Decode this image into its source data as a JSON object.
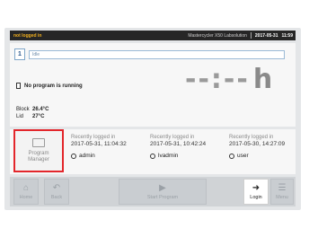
{
  "status": {
    "login_state": "not logged in",
    "model": "Mastercycler X50 Labsolution",
    "date": "2017-05-31",
    "time": "11:59"
  },
  "block": {
    "number": "1",
    "id_value": "Idle"
  },
  "program": {
    "status_text": "No program is running",
    "remaining": "--:--",
    "unit": "h"
  },
  "temperatures": {
    "block_label": "Block",
    "block_value": "26.4°C",
    "lid_label": "Lid",
    "lid_value": "27°C"
  },
  "program_manager": {
    "label_line1": "Program",
    "label_line2": "Manager"
  },
  "recent_users": [
    {
      "title": "Recently logged in",
      "datetime": "2017-05-31, 11:04:32",
      "name": "admin"
    },
    {
      "title": "Recently logged in",
      "datetime": "2017-05-31, 10:42:24",
      "name": "lvadmin"
    },
    {
      "title": "Recently logged in",
      "datetime": "2017-05-30, 14:27:09",
      "name": "user"
    }
  ],
  "nav": {
    "home": "Home",
    "back": "Back",
    "start": "Start Program",
    "login": "Login",
    "menu": "Menu"
  },
  "icons": {
    "home": "house-icon",
    "back": "return-arrow-icon",
    "start": "play-icon",
    "login": "login-icon",
    "menu": "hamburger-menu-icon"
  }
}
